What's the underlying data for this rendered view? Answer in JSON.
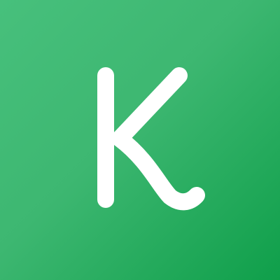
{
  "app_icon": {
    "name": "k-app-icon",
    "logo_letter": "K",
    "colors": {
      "background_start": "#47c07c",
      "background_mid": "#3db771",
      "background_end": "#0f9f4a",
      "glyph": "#ffffff"
    }
  }
}
